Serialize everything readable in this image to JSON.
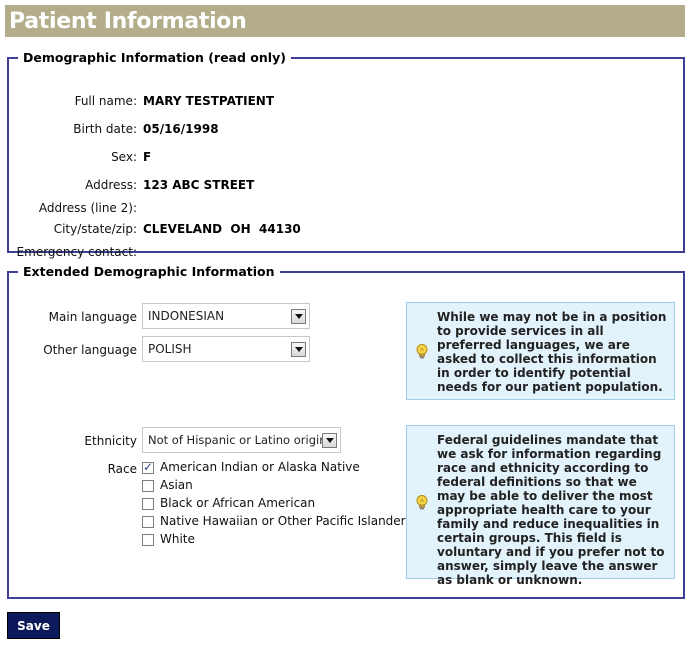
{
  "page": {
    "title": "Patient Information"
  },
  "demographic": {
    "legend": "Demographic Information (read only)",
    "fields": [
      {
        "label": "Full name:",
        "value": "MARY TESTPATIENT"
      },
      {
        "label": "Birth date:",
        "value": "05/16/1998"
      },
      {
        "label": "Sex:",
        "value": "F"
      },
      {
        "label": "Address:",
        "value": "123 ABC STREET"
      },
      {
        "label": "Address (line 2):",
        "value": ""
      },
      {
        "label": "City/state/zip:",
        "value": "CLEVELAND  OH  44130"
      },
      {
        "label": "Emergency contact:",
        "value": ""
      }
    ]
  },
  "extended": {
    "legend": "Extended Demographic Information",
    "main_language": {
      "label": "Main language",
      "value": "INDONESIAN"
    },
    "other_language": {
      "label": "Other language",
      "value": "POLISH"
    },
    "ethnicity": {
      "label": "Ethnicity",
      "value": "Not of Hispanic or Latino origin"
    },
    "race": {
      "label": "Race",
      "options": [
        {
          "label": "American Indian or Alaska Native",
          "checked": true
        },
        {
          "label": "Asian",
          "checked": false
        },
        {
          "label": "Black or African American",
          "checked": false
        },
        {
          "label": "Native Hawaiian or Other Pacific Islander",
          "checked": false
        },
        {
          "label": "White",
          "checked": false
        }
      ]
    },
    "language_info": "While we may not be in a position to provide services in all preferred languages, we are asked to collect this information in order to identify potential needs for our patient population.",
    "race_info": "Federal guidelines mandate that we ask for information regarding race and ethnicity according to federal definitions so that we may be able to deliver the most appropriate health care to your family and reduce inequalities in certain groups. This field is voluntary and if you prefer not to answer, simply leave the answer as blank or unknown."
  },
  "actions": {
    "save_label": "Save"
  },
  "colors": {
    "title_bar": "#b4ad8a",
    "fieldset_border": "#3f3f9a",
    "info_bg": "#e2f3fb",
    "save_bg": "#0c1a5c"
  },
  "icons": {
    "info": "lightbulb-icon",
    "dropdown": "chevron-down-icon",
    "check": "checkmark-icon"
  }
}
